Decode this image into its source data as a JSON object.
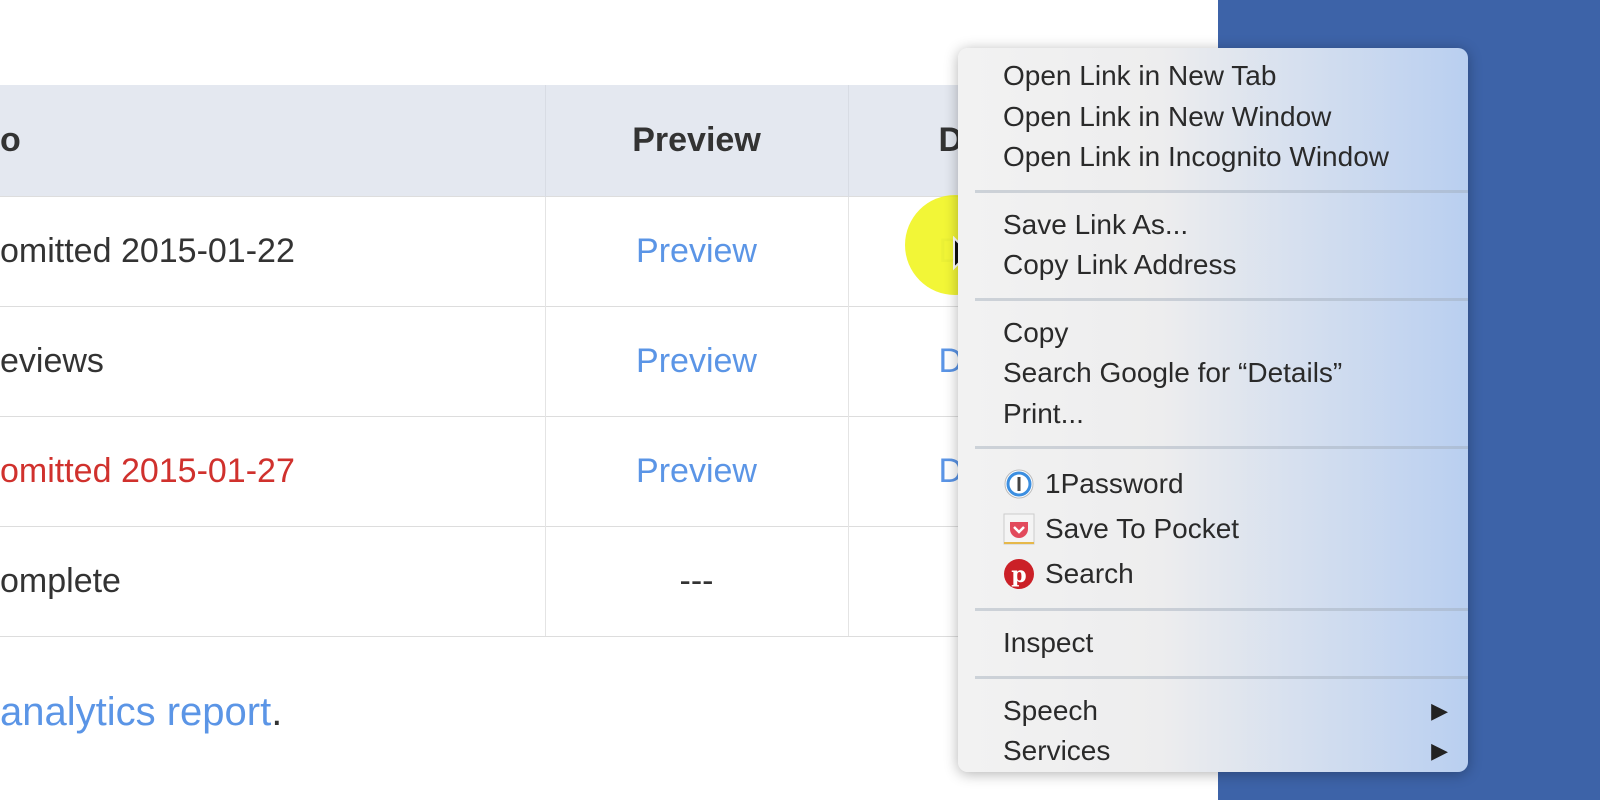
{
  "table": {
    "headers": [
      "o",
      "Preview",
      "D"
    ],
    "rows": [
      {
        "status": "omitted 2015-01-22",
        "preview": "Preview",
        "details": "D",
        "status_color": "default"
      },
      {
        "status": "eviews",
        "preview": "Preview",
        "details": "D",
        "status_color": "default"
      },
      {
        "status": "omitted 2015-01-27",
        "preview": "Preview",
        "details": "D",
        "status_color": "#d0312d"
      },
      {
        "status": "omplete",
        "preview": "---",
        "details": "",
        "status_color": "default"
      }
    ]
  },
  "footer": {
    "link": "analytics report",
    "suffix": "."
  },
  "context_menu": {
    "groups": [
      [
        "Open Link in New Tab",
        "Open Link in New Window",
        "Open Link in Incognito Window"
      ],
      [
        "Save Link As...",
        "Copy Link Address"
      ],
      [
        "Copy",
        "Search Google for “Details”",
        "Print..."
      ],
      [
        "1Password",
        "Save To Pocket",
        "Search"
      ],
      [
        "Inspect"
      ],
      [
        "Speech",
        "Services"
      ]
    ],
    "icons": [
      "1password-icon",
      "pocket-icon",
      "pinterest-icon"
    ]
  },
  "colors": {
    "link": "#5b95e6",
    "side_panel": "#3d63a8",
    "cursor_highlight": "#f0f514"
  }
}
